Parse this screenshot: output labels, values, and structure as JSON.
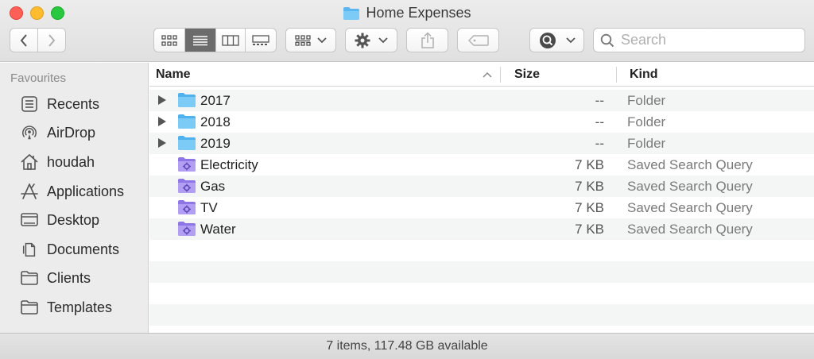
{
  "window": {
    "title": "Home Expenses",
    "traffic_lights": [
      "close",
      "minimize",
      "maximize"
    ]
  },
  "toolbar": {
    "back_icon": "chevron-left-icon",
    "forward_icon": "chevron-right-icon",
    "view_modes": [
      "icon-view",
      "list-view",
      "column-view",
      "gallery-view"
    ],
    "active_view": "list-view",
    "group_icon": "group-grid-icon",
    "action_icon": "gear-icon",
    "share_icon": "share-icon",
    "tag_icon": "tag-icon",
    "quicklook_icon": "search-circle-icon",
    "search_placeholder": "Search"
  },
  "sidebar": {
    "heading": "Favourites",
    "items": [
      {
        "label": "Recents",
        "icon": "recents-icon"
      },
      {
        "label": "AirDrop",
        "icon": "airdrop-icon"
      },
      {
        "label": "houdah",
        "icon": "home-icon"
      },
      {
        "label": "Applications",
        "icon": "applications-icon"
      },
      {
        "label": "Desktop",
        "icon": "desktop-icon"
      },
      {
        "label": "Documents",
        "icon": "documents-icon"
      },
      {
        "label": "Clients",
        "icon": "folder-icon"
      },
      {
        "label": "Templates",
        "icon": "folder-icon"
      }
    ]
  },
  "columns": {
    "name": "Name",
    "size": "Size",
    "kind": "Kind",
    "sort_indicator": "ascending"
  },
  "files": [
    {
      "name": "2017",
      "size": "--",
      "kind": "Folder",
      "type": "folder",
      "expandable": true
    },
    {
      "name": "2018",
      "size": "--",
      "kind": "Folder",
      "type": "folder",
      "expandable": true
    },
    {
      "name": "2019",
      "size": "--",
      "kind": "Folder",
      "type": "folder",
      "expandable": true
    },
    {
      "name": "Electricity",
      "size": "7 KB",
      "kind": "Saved Search Query",
      "type": "smart",
      "expandable": false
    },
    {
      "name": "Gas",
      "size": "7 KB",
      "kind": "Saved Search Query",
      "type": "smart",
      "expandable": false
    },
    {
      "name": "TV",
      "size": "7 KB",
      "kind": "Saved Search Query",
      "type": "smart",
      "expandable": false
    },
    {
      "name": "Water",
      "size": "7 KB",
      "kind": "Saved Search Query",
      "type": "smart",
      "expandable": false
    }
  ],
  "status": {
    "text": "7 items, 117.48 GB available"
  },
  "colors": {
    "folder_blue": "#6ec3f4",
    "smart_folder_purple": "#a78ff0",
    "active_segment": "#6b6b6b"
  }
}
